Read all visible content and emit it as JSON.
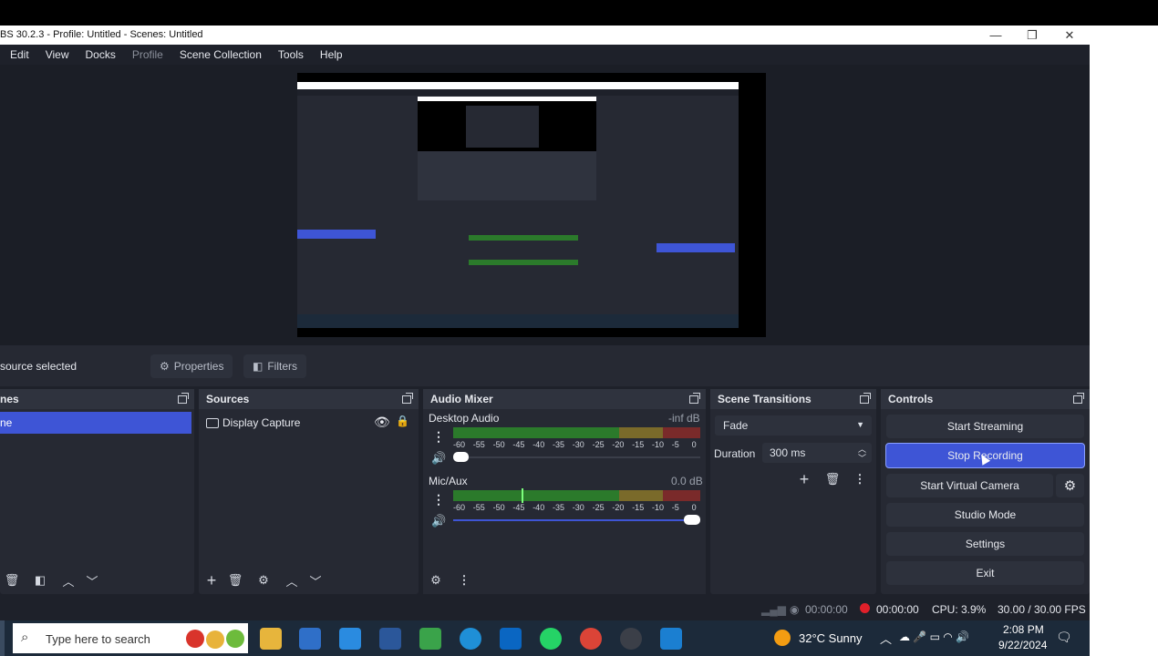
{
  "window": {
    "title": "BS 30.2.3 - Profile: Untitled - Scenes: Untitled"
  },
  "menu": {
    "items": [
      "Edit",
      "View",
      "Docks",
      "Profile",
      "Scene Collection",
      "Tools",
      "Help"
    ]
  },
  "context_bar": {
    "selection": "source selected",
    "properties": "Properties",
    "filters": "Filters"
  },
  "scenes": {
    "title": "nes",
    "items": [
      "ne"
    ]
  },
  "sources": {
    "title": "Sources",
    "items": [
      "Display Capture"
    ]
  },
  "mixer": {
    "title": "Audio Mixer",
    "channels": [
      {
        "name": "Desktop Audio",
        "level": "-inf dB"
      },
      {
        "name": "Mic/Aux",
        "level": "0.0 dB"
      }
    ],
    "ticks": [
      "-60",
      "-55",
      "-50",
      "-45",
      "-40",
      "-35",
      "-30",
      "-25",
      "-20",
      "-15",
      "-10",
      "-5",
      "0"
    ]
  },
  "transitions": {
    "title": "Scene Transitions",
    "selected": "Fade",
    "duration_label": "Duration",
    "duration_value": "300 ms"
  },
  "controls": {
    "title": "Controls",
    "start_streaming": "Start Streaming",
    "stop_recording": "Stop Recording",
    "start_virtual_camera": "Start Virtual Camera",
    "studio_mode": "Studio Mode",
    "settings": "Settings",
    "exit": "Exit"
  },
  "status": {
    "stream_time": "00:00:00",
    "rec_time": "00:00:00",
    "cpu": "CPU: 3.9%",
    "fps": "30.00 / 30.00 FPS"
  },
  "taskbar": {
    "search_placeholder": "Type here to search",
    "weather": "32°C  Sunny",
    "time": "2:08 PM",
    "date": "9/22/2024"
  },
  "colors": {
    "accent": "#3e55d6",
    "record": "#e0202a"
  }
}
